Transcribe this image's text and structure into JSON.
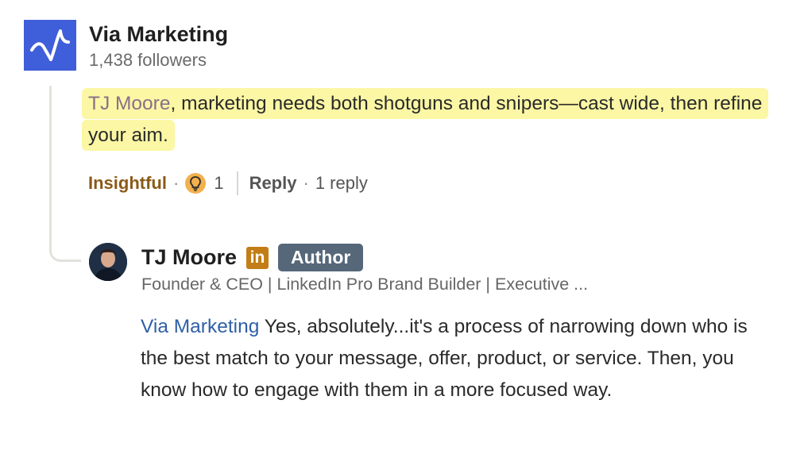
{
  "company": {
    "name": "Via Marketing",
    "followers": "1,438 followers",
    "logo_bg": "#3f5ed9"
  },
  "comment": {
    "mention": "TJ Moore",
    "text": ", marketing needs both shotguns and snipers—cast wide, then refine your aim.",
    "highlight_color": "#fbf7a4"
  },
  "actions": {
    "reaction_label": "Insightful",
    "reaction_icon": "lightbulb-icon",
    "reaction_count": "1",
    "reply_label": "Reply",
    "replies_count": "1 reply"
  },
  "reply": {
    "author_name": "TJ Moore",
    "linkedin_badge": "in",
    "author_badge": "Author",
    "headline": "Founder & CEO | LinkedIn Pro Brand Builder | Executive ...",
    "mention": "Via Marketing",
    "text": " Yes, absolutely...it's a process of narrowing down who is the best match to your message, offer, product, or service. Then, you know how to engage with them in a more focused way."
  }
}
